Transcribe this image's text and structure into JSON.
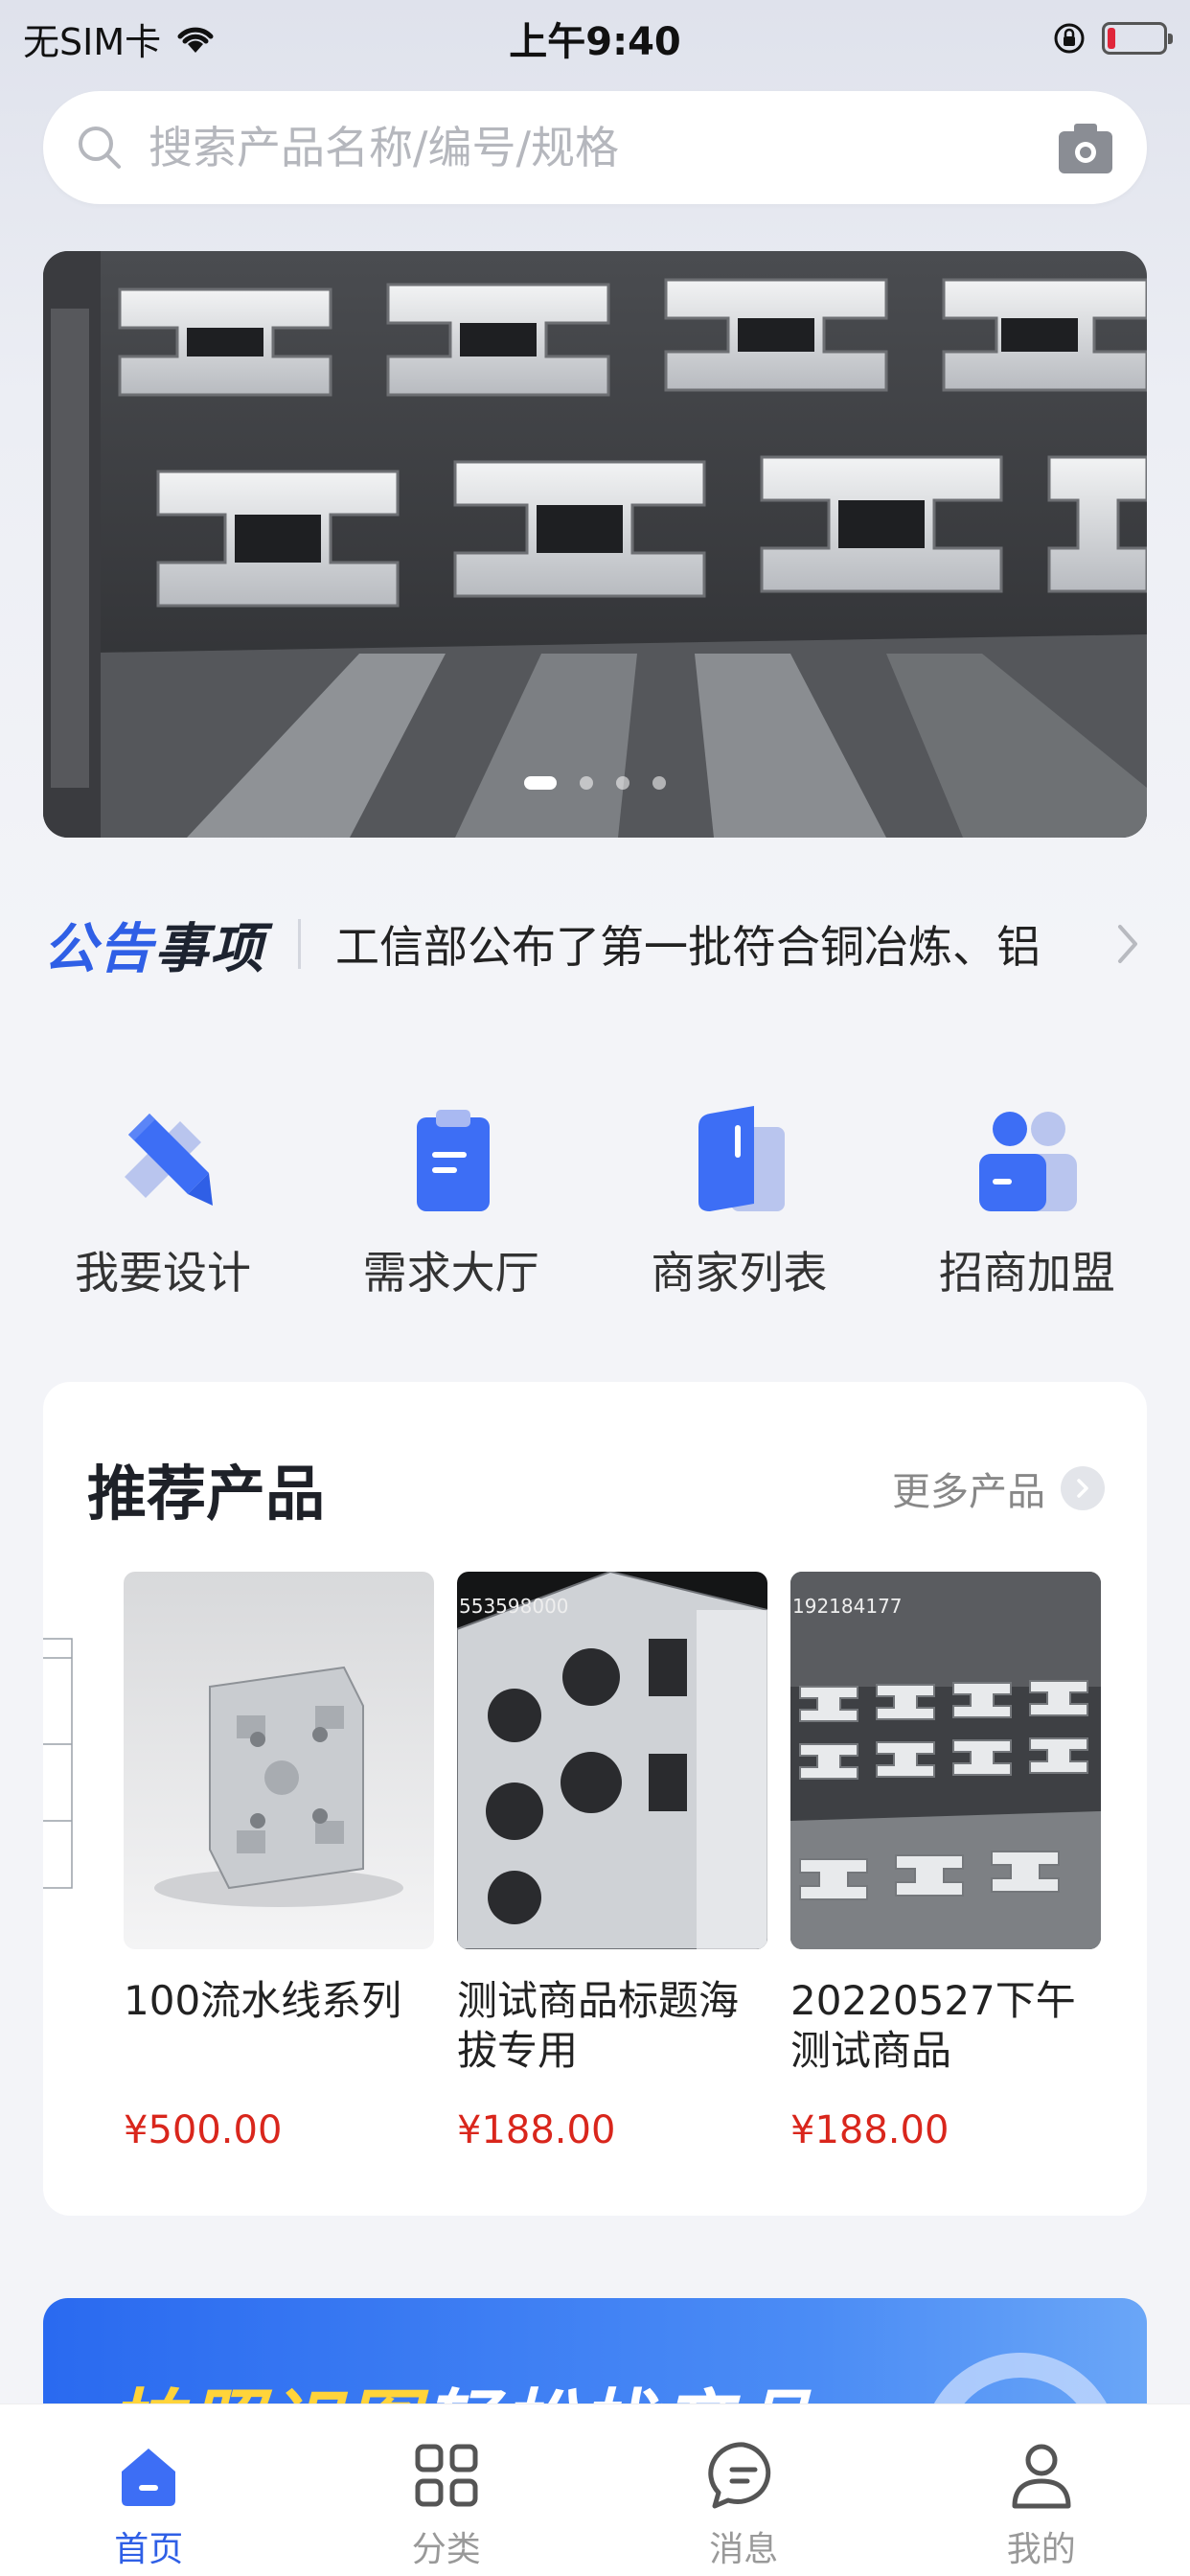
{
  "status_bar": {
    "carrier": "无SIM卡",
    "time": "上午9:40"
  },
  "search": {
    "placeholder": "搜索产品名称/编号/规格",
    "search_icon": "search-icon",
    "camera_icon": "camera-icon"
  },
  "banner": {
    "slide_count": 4,
    "active_index": 0
  },
  "notice": {
    "title_part1": "公告",
    "title_part2": "事项",
    "text": "工信部公布了第一批符合铜冶炼、铝",
    "accent_color": "#2f5fe6"
  },
  "quick_entries": [
    {
      "label": "我要设计",
      "icon": "pencil-ruler-icon"
    },
    {
      "label": "需求大厅",
      "icon": "clipboard-icon"
    },
    {
      "label": "商家列表",
      "icon": "book-icon"
    },
    {
      "label": "招商加盟",
      "icon": "people-icon"
    }
  ],
  "recommend": {
    "title": "推荐产品",
    "more_label": "更多产品",
    "products": [
      {
        "name": "100流水线系列",
        "price": "¥500.00"
      },
      {
        "name": "测试商品标题海拔专用",
        "price": "¥188.00",
        "watermark": "553598000"
      },
      {
        "name": "20220527下午测试商品",
        "price": "¥188.00",
        "watermark": "192184177"
      }
    ],
    "price_color": "#d9261c"
  },
  "promo": {
    "text_yellow": "拍照识图",
    "text_white": "轻松找产品"
  },
  "tabbar": {
    "items": [
      {
        "label": "首页",
        "icon": "home-icon",
        "active": true
      },
      {
        "label": "分类",
        "icon": "grid-icon",
        "active": false
      },
      {
        "label": "消息",
        "icon": "message-icon",
        "active": false
      },
      {
        "label": "我的",
        "icon": "user-icon",
        "active": false
      }
    ],
    "active_color": "#2f5fe6"
  }
}
